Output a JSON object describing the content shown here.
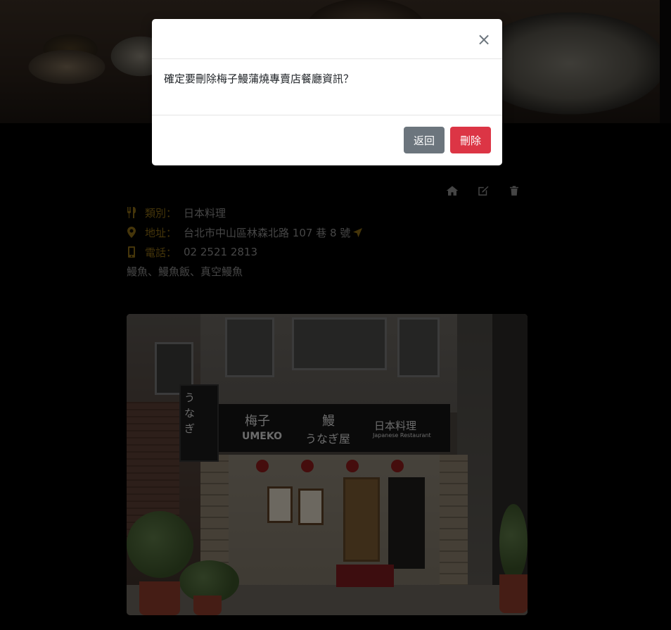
{
  "restaurant": {
    "name": "梅子鰻蒲燒專賣店",
    "category_label": "類別：",
    "category": "日本料理",
    "address_label": "地址：",
    "address": "台北市中山區林森北路 107 巷 8 號",
    "phone_label": "電話：",
    "phone": "02 2521 2813",
    "description": "鰻魚、鰻魚飯、真空鰻魚"
  },
  "actions": {
    "home_icon": "home-icon",
    "edit_icon": "edit-icon",
    "delete_icon": "trash-icon"
  },
  "photo_sign": {
    "name_cn": "梅子",
    "name_en": "UMEKO",
    "eel_char": "鰻",
    "unagi": "うなぎ屋",
    "cuisine": "日本料理",
    "cuisine_en": "Japanese Restaurant",
    "vertical": "うなぎ"
  },
  "modal": {
    "close_symbol": "×",
    "message": "確定要刪除梅子鰻蒲燒專賣店餐廳資訊？",
    "back_label": "返回",
    "delete_label": "刪除"
  },
  "colors": {
    "accent": "#8a6a14",
    "danger": "#dc3545",
    "secondary": "#6c757d"
  }
}
